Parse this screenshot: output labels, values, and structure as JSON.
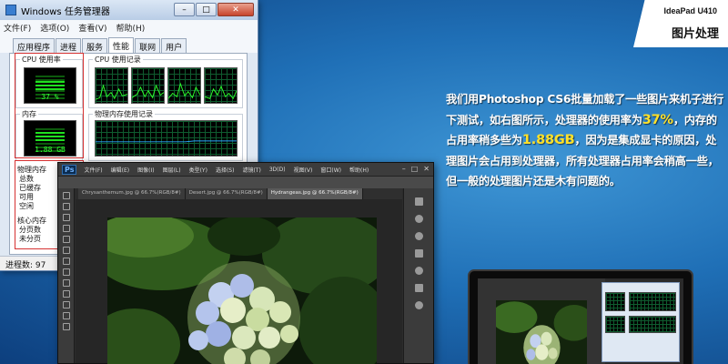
{
  "task_manager": {
    "title": "Windows 任务管理器",
    "window_buttons": [
      "–",
      "□",
      "✕"
    ],
    "menu": [
      "文件(F)",
      "选项(O)",
      "查看(V)",
      "帮助(H)"
    ],
    "tabs": [
      "应用程序",
      "进程",
      "服务",
      "性能",
      "联网",
      "用户"
    ],
    "active_tab": "性能",
    "cpu_usage_label": "CPU 使用率",
    "cpu_usage_value": "37 %",
    "cpu_usage_percent": 37,
    "cpu_history_label": "CPU 使用记录",
    "memory_label": "内存",
    "memory_value": "1.88 GB",
    "memory_fraction": 0.47,
    "memory_history_label": "物理内存使用记录",
    "physical_memory_section": {
      "label": "物理内存",
      "rows": [
        "总数",
        "已缓存",
        "可用",
        "空闲"
      ]
    },
    "kernel_memory_section": {
      "label": "核心内存",
      "rows": [
        "分页数",
        "未分页"
      ]
    },
    "status_processes": "进程数: 97"
  },
  "photoshop": {
    "logo": "Ps",
    "menu": [
      "文件(F)",
      "编辑(E)",
      "图像(I)",
      "图层(L)",
      "类型(Y)",
      "选择(S)",
      "滤镜(T)",
      "3D(D)",
      "视图(V)",
      "窗口(W)",
      "帮助(H)"
    ],
    "window_controls": [
      "–",
      "□",
      "✕"
    ],
    "tabs": [
      "Chrysanthemum.jpg @ 66.7%(RGB/8#)",
      "Desert.jpg @ 66.7%(RGB/8#)",
      "Hydrangeas.jpg @ 66.7%(RGB/8#)"
    ],
    "active_tab_index": 2
  },
  "badge": {
    "model": "IdeaPad U410",
    "title": "图片处理"
  },
  "description": {
    "p1": "我们用Photoshop CS6批量加载了一些图片来机子进行下测试，如右图所示，处理器的使用率为",
    "cpu_value": "37%",
    "p2": "，内存的占用率稍多些为",
    "mem_value": "1.88GB",
    "p3": "，因为是集成显卡的原因，处理图片会占用到处理器，所有处理器占用率会稍高一些，但一般的处理图片还是木有问题的。",
    "highlight_color": "#ffe12a"
  },
  "colors": {
    "background": "#1f6fb6",
    "meter_green": "#20e020",
    "red_box": "#d63232"
  }
}
